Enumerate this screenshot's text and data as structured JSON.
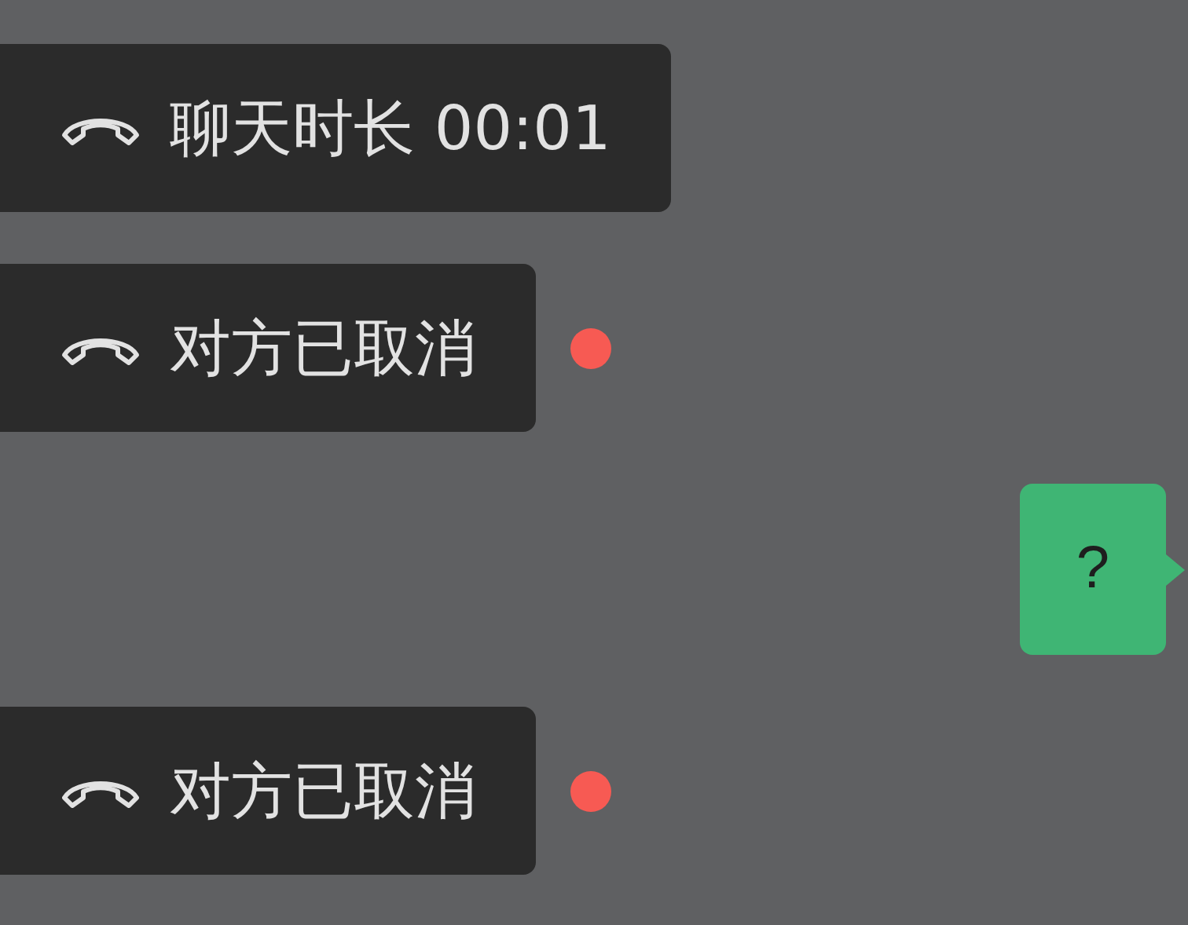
{
  "messages": [
    {
      "kind": "call",
      "text": "聊天时长 00:01",
      "unread": false
    },
    {
      "kind": "call",
      "text": "对方已取消",
      "unread": true
    },
    {
      "kind": "text",
      "text": "?"
    },
    {
      "kind": "call",
      "text": "对方已取消",
      "unread": true
    }
  ]
}
